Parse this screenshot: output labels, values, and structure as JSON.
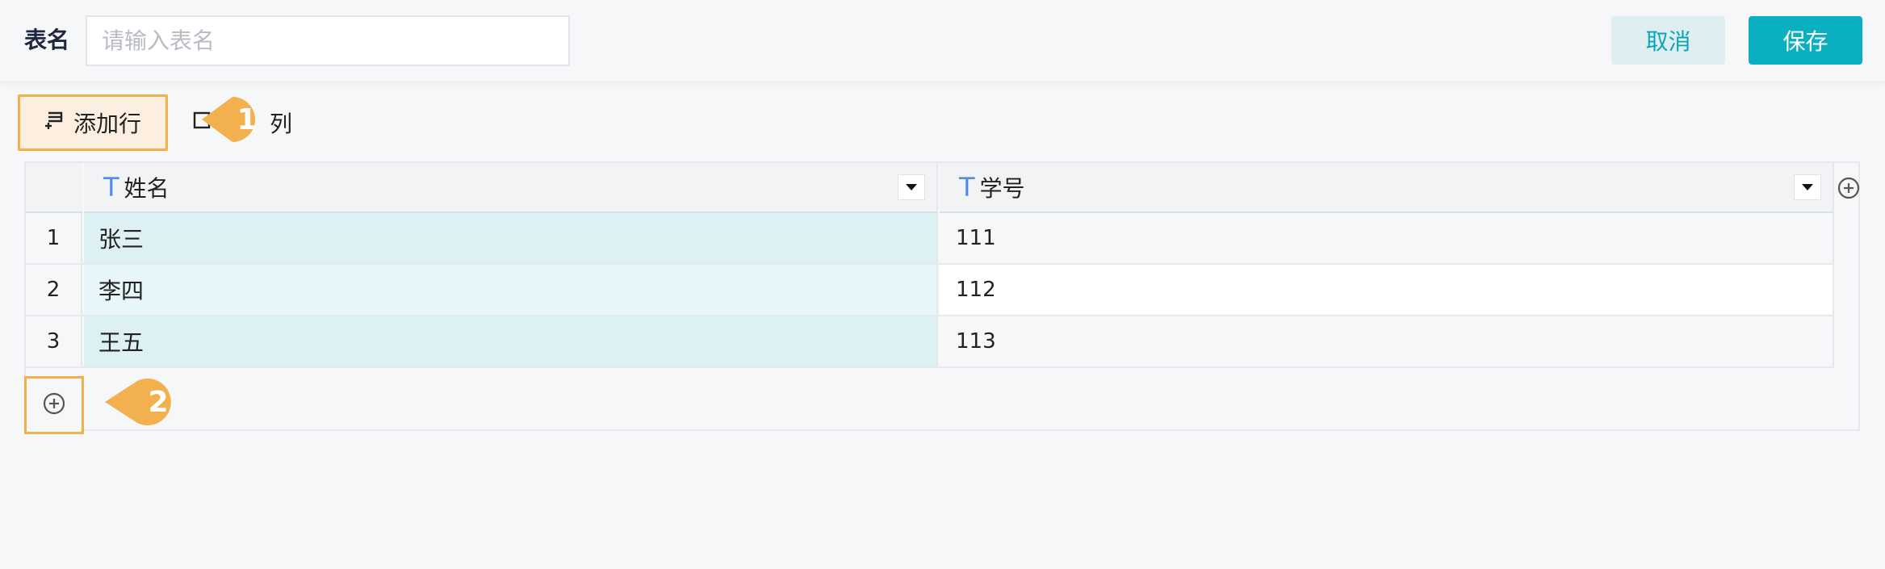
{
  "header": {
    "name_label": "表名",
    "name_placeholder": "请输入表名",
    "name_value": "",
    "cancel_label": "取消",
    "save_label": "保存"
  },
  "toolbar": {
    "add_row_label": "添加行",
    "add_column_label": "列"
  },
  "callouts": [
    "1",
    "2"
  ],
  "table": {
    "columns": [
      {
        "type_icon": "T",
        "label": "姓名"
      },
      {
        "type_icon": "T",
        "label": "学号"
      }
    ],
    "rows": [
      {
        "index": "1",
        "name": "张三",
        "id": "111"
      },
      {
        "index": "2",
        "name": "李四",
        "id": "112"
      },
      {
        "index": "3",
        "name": "王五",
        "id": "113"
      }
    ]
  },
  "colors": {
    "accent": "#0ab0c0",
    "highlight_border": "#f2b04a",
    "highlight_fill": "#fcefe0",
    "selected_column": "#ddf0f3",
    "type_icon": "#4e8cf0"
  },
  "icons": {
    "add_row": "add-row-icon",
    "add_column": "add-column-icon",
    "column_menu": "caret-down-icon",
    "add": "plus-circle-icon"
  }
}
